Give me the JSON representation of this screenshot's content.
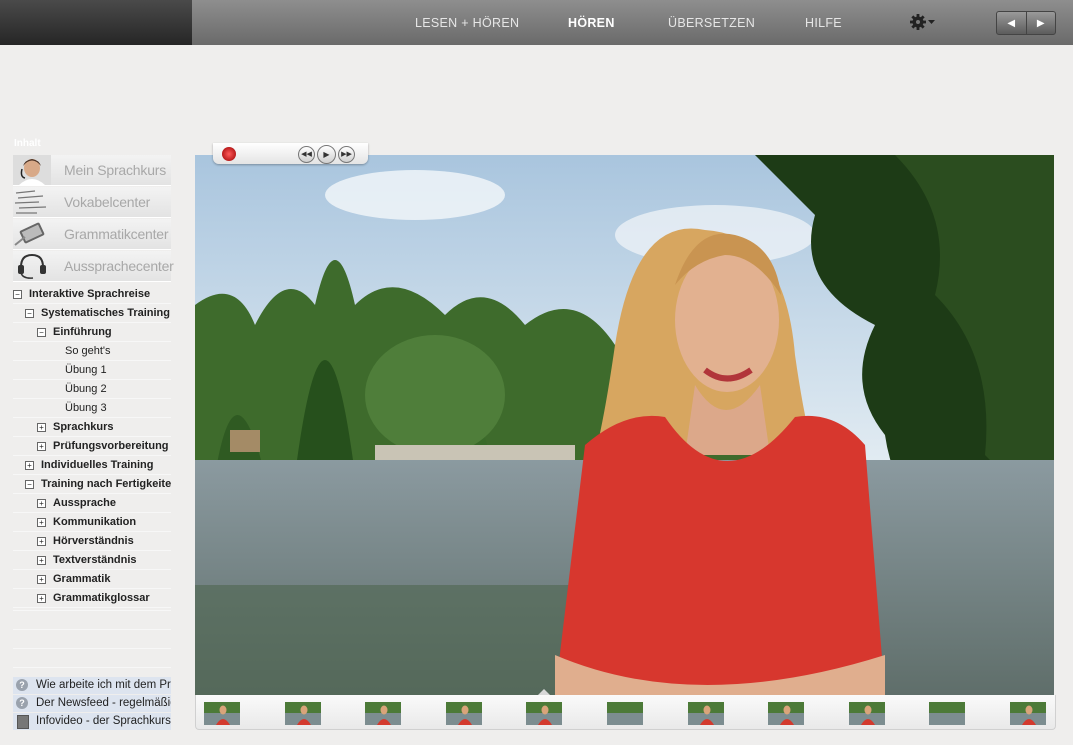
{
  "nav": {
    "items": [
      {
        "label": "LESEN + HÖREN",
        "active": false
      },
      {
        "label": "HÖREN",
        "active": true
      },
      {
        "label": "ÜBERSETZEN",
        "active": false
      },
      {
        "label": "HILFE",
        "active": false
      }
    ],
    "settings_icon": "gear-icon",
    "prev_icon": "triangle-left-icon",
    "next_icon": "triangle-right-icon"
  },
  "sidebar": {
    "title": "Inhalt",
    "menu": [
      {
        "label": "Mein Sprachkurs",
        "active": true,
        "icon": "avatar-icon"
      },
      {
        "label": "Vokabelcenter",
        "active": false,
        "icon": "vocabulary-icon"
      },
      {
        "label": "Grammatikcenter",
        "active": false,
        "icon": "tablet-icon"
      },
      {
        "label": "Aussprachecenter",
        "active": false,
        "icon": "headset-icon"
      }
    ],
    "tree": [
      {
        "label": "Interaktive Sprachreise",
        "level": 0,
        "toggle": "−",
        "bold": true
      },
      {
        "label": "Systematisches Training",
        "level": 1,
        "toggle": "−",
        "bold": true
      },
      {
        "label": "Einführung",
        "level": 2,
        "toggle": "−",
        "bold": true
      },
      {
        "label": "So geht's",
        "level": 3,
        "toggle": "",
        "bold": false
      },
      {
        "label": "Übung 1",
        "level": 3,
        "toggle": "",
        "bold": false
      },
      {
        "label": "Übung 2",
        "level": 3,
        "toggle": "",
        "bold": false
      },
      {
        "label": "Übung 3",
        "level": 3,
        "toggle": "",
        "bold": false
      },
      {
        "label": "Sprachkurs",
        "level": 2,
        "toggle": "+",
        "bold": true
      },
      {
        "label": "Prüfungsvorbereitung",
        "level": 2,
        "toggle": "+",
        "bold": true
      },
      {
        "label": "Individuelles Training",
        "level": 1,
        "toggle": "+",
        "bold": true
      },
      {
        "label": "Training nach Fertigkeiten",
        "level": 1,
        "toggle": "−",
        "bold": true
      },
      {
        "label": "Aussprache",
        "level": 2,
        "toggle": "+",
        "bold": true
      },
      {
        "label": "Kommunikation",
        "level": 2,
        "toggle": "+",
        "bold": true
      },
      {
        "label": "Hörverständnis",
        "level": 2,
        "toggle": "+",
        "bold": true
      },
      {
        "label": "Textverständnis",
        "level": 2,
        "toggle": "+",
        "bold": true
      },
      {
        "label": "Grammatik",
        "level": 2,
        "toggle": "+",
        "bold": true
      },
      {
        "label": "Grammatikglossar",
        "level": 2,
        "toggle": "+",
        "bold": true
      }
    ],
    "help_links": [
      {
        "label": "Wie arbeite ich mit dem Programm",
        "icon": "question-icon"
      },
      {
        "label": "Der Newsfeed - regelmäßig",
        "icon": "question-icon"
      },
      {
        "label": "Infovideo - der Sprachkurs",
        "icon": "film-icon"
      }
    ]
  },
  "player": {
    "record_icon": "record-icon",
    "rewind_icon": "rewind-icon",
    "play_icon": "play-icon",
    "forward_icon": "fast-forward-icon",
    "thumbnails": 11,
    "active_thumbnail": 4
  }
}
